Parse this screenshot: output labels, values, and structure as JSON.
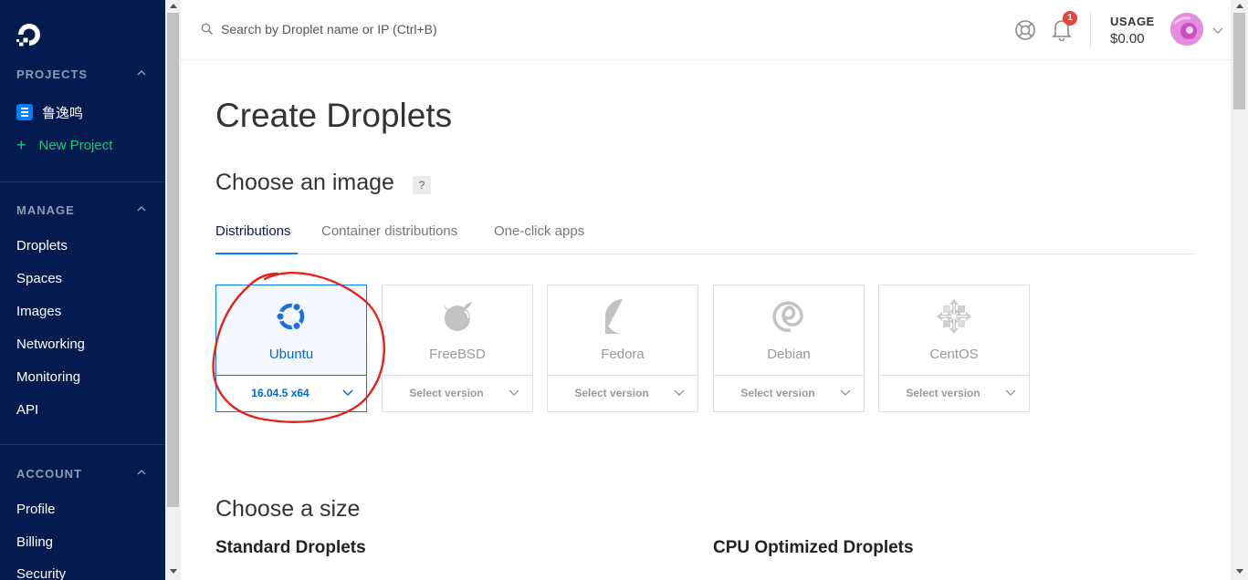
{
  "sidebar": {
    "sections": {
      "projects": "PROJECTS",
      "manage": "MANAGE",
      "account": "ACCOUNT"
    },
    "project_name": "鲁逸鸣",
    "new_project": "New Project",
    "manage_items": [
      "Droplets",
      "Spaces",
      "Images",
      "Networking",
      "Monitoring",
      "API"
    ],
    "account_items": [
      "Profile",
      "Billing",
      "Security"
    ]
  },
  "topbar": {
    "search_placeholder": "Search by Droplet name or IP (Ctrl+B)",
    "notification_count": "1",
    "usage_label": "USAGE",
    "usage_value": "$0.00"
  },
  "main": {
    "title": "Create Droplets",
    "image_section": "Choose an image",
    "help": "?",
    "tabs": [
      "Distributions",
      "Container distributions",
      "One-click apps"
    ],
    "active_tab": "Distributions",
    "distros": [
      {
        "name": "Ubuntu",
        "version": "16.04.5 x64",
        "icon": "ubuntu-icon",
        "selected": true
      },
      {
        "name": "FreeBSD",
        "version": "Select version",
        "icon": "freebsd-icon",
        "selected": false
      },
      {
        "name": "Fedora",
        "version": "Select version",
        "icon": "fedora-icon",
        "selected": false
      },
      {
        "name": "Debian",
        "version": "Select version",
        "icon": "debian-icon",
        "selected": false
      },
      {
        "name": "CentOS",
        "version": "Select version",
        "icon": "centos-icon",
        "selected": false
      }
    ],
    "size_section": "Choose a size",
    "standard": "Standard Droplets",
    "cpu_optimized": "CPU Optimized Droplets"
  },
  "colors": {
    "sidebar_bg": "#031b4e",
    "accent": "#0080ff",
    "new_project": "#15cd72",
    "badge": "#e8453c",
    "annotation": "#e3231a"
  }
}
